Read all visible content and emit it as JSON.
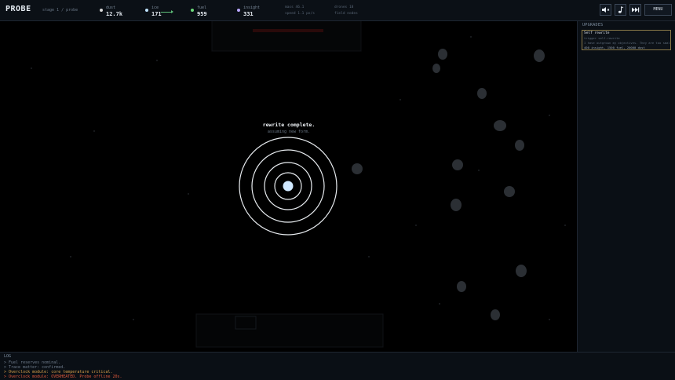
{
  "app": {
    "title": "PROBE",
    "stage": "stage 1 / probe"
  },
  "resources": [
    {
      "name": "dust",
      "value": "12.7k",
      "color": "#d8d8d8"
    },
    {
      "name": "ice",
      "value": "171",
      "color": "#bfe3ff"
    },
    {
      "name": "fuel",
      "value": "959",
      "color": "#6cd87a"
    },
    {
      "name": "insight",
      "value": "331",
      "color": "#b9a7ff"
    }
  ],
  "stats": {
    "mass": "mass 46.1",
    "speed": "speed 1.1 px/s",
    "drones": "drones 18",
    "field": "field nodes"
  },
  "controls": {
    "sound_icon": "speaker-icon",
    "music_icon": "music-note-icon",
    "skip_icon": "fast-forward-icon",
    "menu_label": "MENU"
  },
  "upgrades": {
    "title": "UPGRADES",
    "items": [
      {
        "name": "Self rewrite",
        "desc1": "trigger self-rewrite",
        "desc2": "I have outgrown my objectives. They are too small.",
        "cost": "400 insight, 1500 fuel, 20000 dust"
      }
    ]
  },
  "message": {
    "title": "rewrite complete.",
    "subtitle": "assuming new form."
  },
  "log": {
    "title": "LOG",
    "lines": [
      {
        "text": "> Fuel reserves nominal.",
        "color": "#6f7c8c"
      },
      {
        "text": "> Trace matter: confirmed.",
        "color": "#6f7c8c"
      },
      {
        "text": "> Overclock module: core temperature critical.",
        "color": "#d8a04a"
      },
      {
        "text": "> Overclock module: OVERHEATED. Probe offline 20s.",
        "color": "#e0593c"
      }
    ]
  }
}
